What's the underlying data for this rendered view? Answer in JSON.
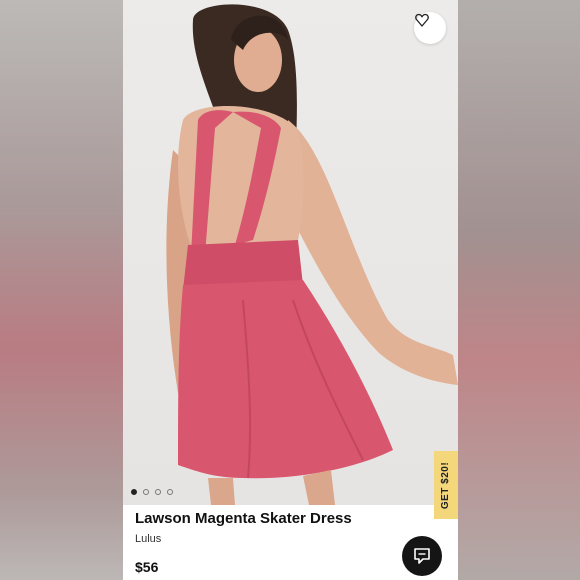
{
  "product": {
    "title": "Lawson Magenta Skater Dress",
    "brand": "Lulus",
    "price": "$56",
    "image_count": 4,
    "active_image_index": 0
  },
  "promo": {
    "label": "GET $20!"
  },
  "icons": {
    "favorite": "heart-icon",
    "chat": "chat-bubble-icon"
  },
  "colors": {
    "dress": "#d9566f",
    "promo_tab": "#f4d77b",
    "chat_button": "#151515"
  }
}
